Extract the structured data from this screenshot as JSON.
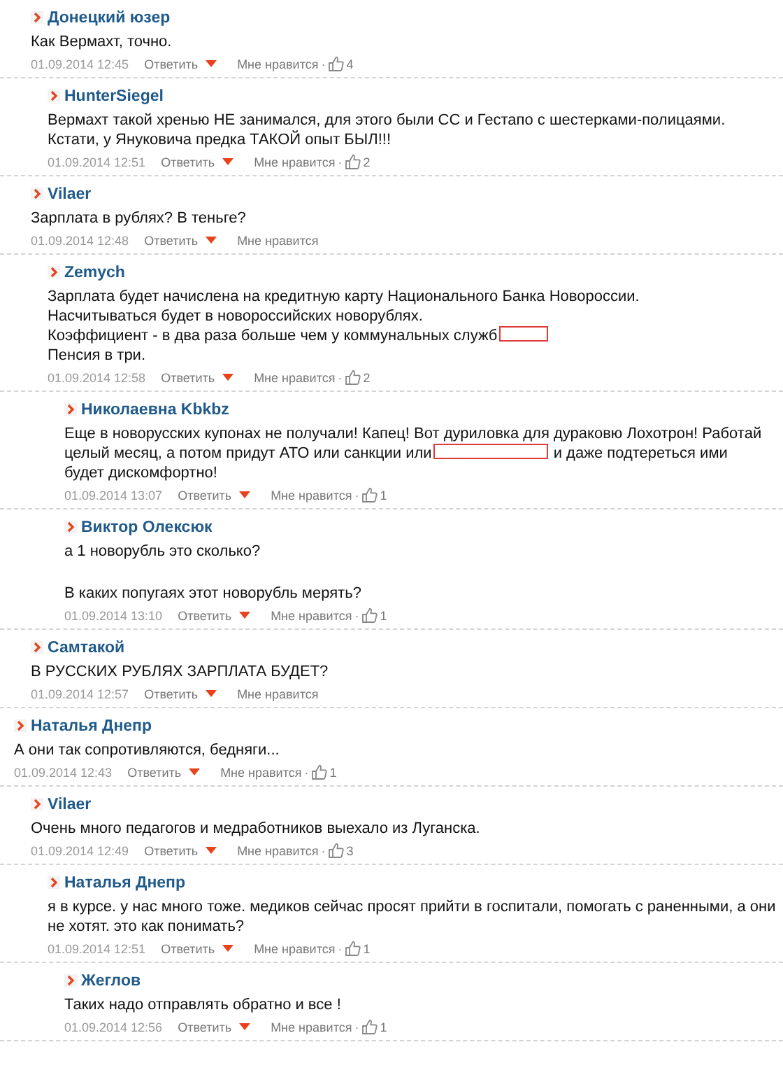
{
  "like_separator": "·",
  "continued_replies": [
    {
      "author": "Донецкий юзер",
      "blocks": [
        {
          "parts": [
            {
              "kind": "text",
              "text": "Как Вермахт, точно."
            }
          ]
        }
      ],
      "date": "01.09.2014 12:45",
      "reply": "Ответить",
      "like": "Мне нравится",
      "likes": "4",
      "children": [
        {
          "author": "HunterSiegel",
          "blocks": [
            {
              "parts": [
                {
                  "kind": "text",
                  "text": "Вермахт такой хренью НЕ занимался, для этого были СС и Гестапо с шестерками-полицаями. Кстати, у Януковича предка ТАКОЙ опыт БЫЛ!!!"
                }
              ]
            }
          ],
          "date": "01.09.2014 12:51",
          "reply": "Ответить",
          "like": "Мне нравится",
          "likes": "2"
        }
      ]
    },
    {
      "author": "Vilaer",
      "blocks": [
        {
          "parts": [
            {
              "kind": "text",
              "text": "Зарплата в рублях? В теньге?"
            }
          ]
        }
      ],
      "date": "01.09.2014 12:48",
      "reply": "Ответить",
      "like": "Мне нравится",
      "children": [
        {
          "author": "Zemych",
          "blocks": [
            {
              "parts": [
                {
                  "kind": "text",
                  "text": "Зарплата будет начислена на кредитную карту Национального Банка Новороссии."
                }
              ]
            },
            {
              "parts": [
                {
                  "kind": "text",
                  "text": "Насчитываться будет в новороссийских новорублях."
                }
              ]
            },
            {
              "parts": [
                {
                  "kind": "text",
                  "text": "Коэффициент - в два раза больше чем у коммунальных служб"
                },
                {
                  "kind": "redacted"
                }
              ]
            },
            {
              "parts": [
                {
                  "kind": "text",
                  "text": "Пенсия в три."
                }
              ]
            }
          ],
          "date": "01.09.2014 12:58",
          "reply": "Ответить",
          "like": "Мне нравится",
          "likes": "2",
          "children": [
            {
              "author": "Николаевна Kbkbz",
              "blocks": [
                {
                  "parts": [
                    {
                      "kind": "text",
                      "text": "Еще в новорусских купонах не получали! Капец! Вот дуриловка для дураковю Лохотрон! Работай"
                    }
                  ]
                },
                {
                  "parts": [
                    {
                      "kind": "text",
                      "text": "целый месяц, а потом придут АТО или санкции или"
                    },
                    {
                      "kind": "redacted"
                    },
                    {
                      "kind": "text",
                      "text": "и даже подтереться ими"
                    }
                  ]
                },
                {
                  "parts": [
                    {
                      "kind": "text",
                      "text": "будет дискомфортно!"
                    }
                  ]
                }
              ],
              "date": "01.09.2014 13:07",
              "reply": "Ответить",
              "like": "Мне нравится",
              "likes": "1"
            },
            {
              "author": "Виктор Олексюк",
              "blocks": [
                {
                  "parts": [
                    {
                      "kind": "text",
                      "text": "а 1 новорубль это сколько?"
                    }
                  ]
                },
                {
                  "blank_line_before": true,
                  "parts": [
                    {
                      "kind": "text",
                      "text": "В каких попугаях этот новорубль мерять?"
                    }
                  ]
                }
              ],
              "date": "01.09.2014 13:10",
              "reply": "Ответить",
              "like": "Мне нравится",
              "likes": "1"
            }
          ]
        }
      ]
    },
    {
      "author": "Самтакой",
      "blocks": [
        {
          "parts": [
            {
              "kind": "text",
              "text": "В РУССКИХ РУБЛЯХ ЗАРПЛАТА БУДЕТ?"
            }
          ]
        }
      ],
      "date": "01.09.2014 12:57",
      "reply": "Ответить",
      "like": "Мне нравится"
    }
  ],
  "comments": [
    {
      "author": "Наталья Днепр",
      "blocks": [
        {
          "parts": [
            {
              "kind": "text",
              "text": "А они так сопротивляются, бедняги..."
            }
          ]
        }
      ],
      "date": "01.09.2014 12:43",
      "reply": "Ответить",
      "like": "Мне нравится",
      "likes": "1",
      "children": [
        {
          "author": "Vilaer",
          "blocks": [
            {
              "parts": [
                {
                  "kind": "text",
                  "text": "Очень много педагогов и медработников выехало из Луганска."
                }
              ]
            }
          ],
          "date": "01.09.2014 12:49",
          "reply": "Ответить",
          "like": "Мне нравится",
          "likes": "3",
          "children": [
            {
              "author": "Наталья Днепр",
              "blocks": [
                {
                  "parts": [
                    {
                      "kind": "text",
                      "text": "я в курсе. у нас много тоже. медиков сейчас просят прийти в госпитали, помогать с раненными, а они не хотят. это как понимать?"
                    }
                  ]
                }
              ],
              "date": "01.09.2014 12:51",
              "reply": "Ответить",
              "like": "Мне нравится",
              "likes": "1",
              "children": [
                {
                  "author": "Жеглов",
                  "blocks": [
                    {
                      "parts": [
                        {
                          "kind": "text",
                          "text": "Таких надо отправлять обратно и все !"
                        }
                      ]
                    }
                  ],
                  "date": "01.09.2014 12:56",
                  "reply": "Ответить",
                  "like": "Мне нравится",
                  "likes": "1"
                }
              ]
            }
          ]
        }
      ]
    }
  ]
}
